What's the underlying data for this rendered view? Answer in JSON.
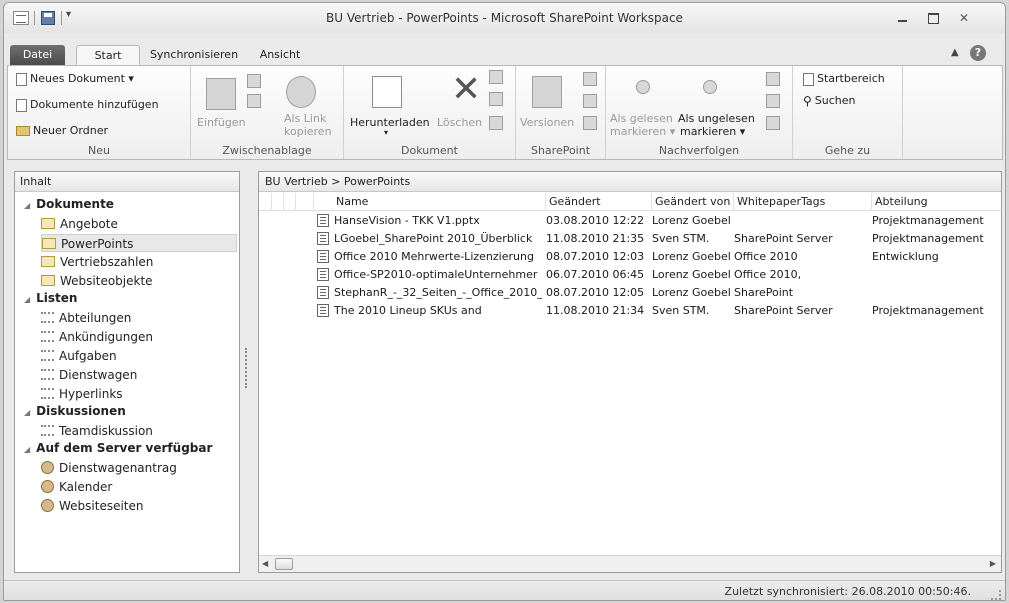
{
  "window": {
    "title": "BU Vertrieb - PowerPoints  -  Microsoft SharePoint Workspace",
    "help_icon": "?"
  },
  "tabs": [
    "Datei",
    "Start",
    "Synchronisieren",
    "Ansicht"
  ],
  "ribbon": {
    "neu": {
      "label": "Neu",
      "neues_dokument": "Neues Dokument",
      "dokumente_hinzufuegen": "Dokumente hinzufügen",
      "neuer_ordner": "Neuer Ordner"
    },
    "zwischenablage": {
      "label": "Zwischenablage",
      "einfuegen": "Einfügen",
      "als_link_1": "Als Link",
      "als_link_2": "kopieren"
    },
    "dokument": {
      "label": "Dokument",
      "herunterladen": "Herunterladen",
      "loeschen": "Löschen"
    },
    "sharepoint": {
      "label": "SharePoint",
      "versionen": "Versionen"
    },
    "nachverfolgen": {
      "label": "Nachverfolgen",
      "als_gelesen_1": "Als gelesen",
      "als_gelesen_2": "markieren",
      "als_ungelesen_1": "Als ungelesen",
      "als_ungelesen_2": "markieren"
    },
    "gehe_zu": {
      "label": "Gehe zu",
      "startbereich": "Startbereich",
      "suchen": "Suchen"
    }
  },
  "nav": {
    "header": "Inhalt",
    "sections": [
      {
        "title": "Dokumente",
        "items": [
          "Angebote",
          "PowerPoints",
          "Vertriebszahlen",
          "Websiteobjekte"
        ]
      },
      {
        "title": "Listen",
        "items": [
          "Abteilungen",
          "Ankündigungen",
          "Aufgaben",
          "Dienstwagen",
          "Hyperlinks"
        ]
      },
      {
        "title": "Diskussionen",
        "items": [
          "Teamdiskussion"
        ]
      },
      {
        "title": "Auf dem Server verfügbar",
        "items": [
          "Dienstwagenantrag",
          "Kalender",
          "Websiteseiten"
        ]
      }
    ],
    "selected": "PowerPoints"
  },
  "main": {
    "breadcrumb": "BU Vertrieb > PowerPoints",
    "columns": [
      "Name",
      "Geändert",
      "Geändert von",
      "WhitepaperTags",
      "Abteilung"
    ],
    "rows": [
      [
        "HanseVision - TKK V1.pptx",
        "03.08.2010 12:22",
        "Lorenz Goebel",
        "",
        "Projektmanagement"
      ],
      [
        "LGoebel_SharePoint 2010_Überblick",
        "11.08.2010 21:35",
        "Sven STM.",
        "SharePoint Server",
        "Projektmanagement"
      ],
      [
        "Office 2010 Mehrwerte-Lizenzierung",
        "08.07.2010 12:03",
        "Lorenz Goebel",
        "Office 2010",
        "Entwicklung"
      ],
      [
        "Office-SP2010-optimaleUnternehmer",
        "06.07.2010 06:45",
        "Lorenz Goebel",
        "Office 2010,",
        ""
      ],
      [
        "StephanR_-_32_Seiten_-_Office_2010_",
        "08.07.2010 12:05",
        "Lorenz Goebel",
        "SharePoint",
        ""
      ],
      [
        "The 2010 Lineup SKUs and",
        "11.08.2010 21:34",
        "Sven STM.",
        "SharePoint Server",
        "Projektmanagement"
      ]
    ]
  },
  "status": {
    "text": "Zuletzt synchronisiert: 26.08.2010 00:50:46."
  }
}
